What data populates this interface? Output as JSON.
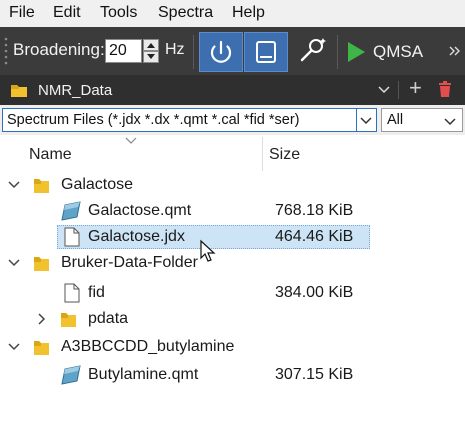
{
  "menu": {
    "items": [
      {
        "label": "File"
      },
      {
        "label": "Edit"
      },
      {
        "label": "Tools"
      },
      {
        "label": "Spectra"
      },
      {
        "label": "Help"
      }
    ]
  },
  "toolbar": {
    "broadening_label": "Broadening:",
    "broadening_value": "20",
    "broadening_unit": "Hz",
    "qmsa_label": "QMSA"
  },
  "location": {
    "folder": "NMR_Data",
    "add_glyph": "+"
  },
  "filter": {
    "spectrum_files": "Spectrum Files (*.jdx *.dx *.qmt *.cal *fid *ser)",
    "type": "All"
  },
  "tree": {
    "columns": {
      "name": "Name",
      "size": "Size"
    },
    "rows": [
      {
        "name": "Galactose",
        "size": "",
        "icon": "folder-icon",
        "expander": "expanded"
      },
      {
        "name": "Galactose.qmt",
        "size": "768.18 KiB",
        "icon": "qmt-file-icon"
      },
      {
        "name": "Galactose.jdx",
        "size": "464.46 KiB",
        "icon": "document-icon",
        "selected": true
      },
      {
        "name": "Bruker-Data-Folder",
        "size": "",
        "icon": "folder-icon",
        "expander": "expanded"
      },
      {
        "name": "fid",
        "size": "384.00 KiB",
        "icon": "document-icon"
      },
      {
        "name": "pdata",
        "size": "",
        "icon": "folder-icon",
        "expander": "collapsed"
      },
      {
        "name": "A3BBCCDD_butylamine",
        "size": "",
        "icon": "folder-icon",
        "expander": "expanded"
      },
      {
        "name": "Butylamine.qmt",
        "size": "307.15 KiB",
        "icon": "qmt-file-icon"
      }
    ]
  },
  "colors": {
    "toolbar_bg": "#3b3b3b",
    "active_button": "#3d6fb0",
    "folder": "#f2c12e",
    "selection": "#cde4f7",
    "delete_red": "#e04e4e",
    "play_green": "#3fb548"
  }
}
